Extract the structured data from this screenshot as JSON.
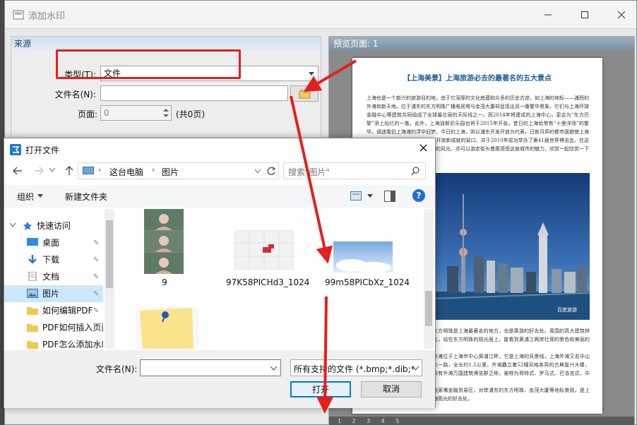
{
  "main_window": {
    "title": "添加水印",
    "source": {
      "header": "来源",
      "type_label": "类型(T):",
      "type_value": "文件",
      "filename_label": "文件名(N):",
      "filename_value": "",
      "page_label": "页面:",
      "page_value": "0",
      "page_total": "(共0页)"
    },
    "preview": {
      "header": "预览页面: 1",
      "doc_title": "【上海美景】上海旅游必去的最著名的五大景点",
      "para1": "上海也是一个新兴的旅游目的地，由于它深厚的文化底蕴和众多的历史古迹，如上海的地标——浦西的外滩和新天地。位于浦东的东方明珠广播电视塔与金茂大厦却呈现出另一番繁华景象，它们与上海环球金融中心等建筑共同组成了全球最壮丽的天际线之一。而2014年将建成的上海中心，更会为“东方巴黎”添上灿烂的一笔。此外，上海迪斯尼乐园也将于2015年开张。昔日的上海给带有“十里洋场”的繁华，谪迷看旧上海滩的浮华旧梦。今日的上海，则以浦东开发开放为代表，日新月异的都市面貌使上海成为了一个充满活力、正在不断开放新成就的窗口，并于2010年成功举办了第41届世界博览会。在这里，你可以尽情享受上海最美丽的风光，亦可以游走街头巷尾感受这座城市的魅力，欣赏一起欣赏一下上海最美的地方。",
      "para2": "东方明珠是上海最著名的地方，也是乘游的好去处。周围的高大建筑林立，站在东方明珠的观光层上，能看到黄浦江两岸壮观的景色和美丽的灯光。适合夜晚去参观。",
      "para3": "外滩位于上海市中心黄浦江畔，它是上海的风景线，上海外滩又名中山东一路，全长约1.5公里，外滩矗立着52幢风格各异的古典复兴大楼，素有外滩万国建筑博览群之称，被称为哥特式、罗马式、巴洛克式、中西合璧式等52幢风格各异的大楼，被称为万国建筑博览群。这些古典主义与现代主义并存的建筑。",
      "para4": "陆家嘴金融贸易区，对岸浦东的东方明珠、金茂大厦等地标景观，是上海观光的好去处。",
      "watermark": "百度旅游",
      "pages": [
        "1",
        "2",
        "3",
        "4",
        "5"
      ]
    }
  },
  "dialog": {
    "title": "打开文件",
    "close": "×",
    "path": [
      "这台电脑",
      "图片"
    ],
    "search_placeholder": "搜索\"图片\"",
    "organize": "组织",
    "new_folder": "新建文件夹",
    "help": "?",
    "nav": {
      "quick_access": "快速访问",
      "items": [
        "桌面",
        "下载",
        "文档",
        "图片",
        "如何编辑PDF",
        "PDF如何插入页面",
        "PDF怎么添加水印"
      ]
    },
    "files": [
      {
        "name": "9"
      },
      {
        "name": "97K58PICHd3_1024"
      },
      {
        "name": "99m58PICbXz_1024"
      },
      {
        "name": ""
      }
    ],
    "filename_label": "文件名(N):",
    "filename_value": "",
    "filetype_value": "所有支持的文件 (*.bmp;*.dib;*",
    "open_button": "打开",
    "cancel_button": "取消"
  },
  "colors": {
    "arrow": "#e5201c",
    "selection": "#cce8ff",
    "accent": "#0078d7",
    "title_blue": "#1f5d96"
  }
}
